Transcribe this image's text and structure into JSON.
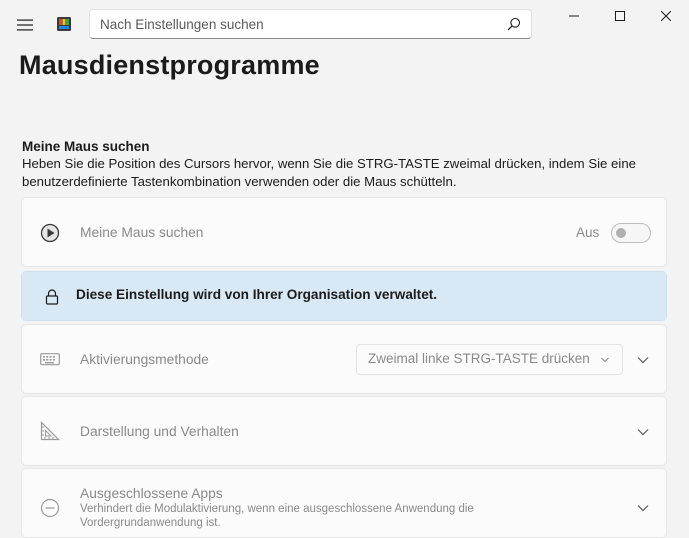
{
  "search": {
    "placeholder": "Nach Einstellungen suchen"
  },
  "page": {
    "title": "Mausdienstprogramme"
  },
  "section": {
    "title": "Meine Maus suchen",
    "description": "Heben Sie die Position des Cursors hervor, wenn Sie die STRG-TASTE zweimal drücken, indem Sie eine benutzerdefinierte Tastenkombination verwenden oder die Maus schütteln."
  },
  "enable_card": {
    "label": "Meine Maus suchen",
    "toggle_state": "Aus",
    "toggle_on": false
  },
  "info_bar": {
    "text": "Diese Einstellung wird von Ihrer Organisation verwaltet."
  },
  "activation_card": {
    "label": "Aktivierungsmethode",
    "selected_value": "Zweimal linke STRG-TASTE drücken"
  },
  "appearance_card": {
    "label": "Darstellung und Verhalten"
  },
  "excluded_card": {
    "label": "Ausgeschlossene Apps",
    "description": "Verhindert die Modulaktivierung, wenn eine ausgeschlossene Anwendung die Vordergrundanwendung ist."
  },
  "colors": {
    "info_background": "#d9e8f5",
    "card_background": "#fbfbfb",
    "window_background": "#f3f3f3",
    "disabled_text": "#8a8a8a"
  },
  "icons": {
    "menu": "hamburger-icon",
    "app": "powertoys-icon",
    "search": "search-icon",
    "minimize": "minimize-icon",
    "maximize": "maximize-icon",
    "close": "close-icon",
    "enable": "find-mouse-icon",
    "info": "lock-icon",
    "activation": "keyboard-icon",
    "appearance": "appearance-icon",
    "excluded": "block-icon",
    "expand": "chevron-down-icon"
  }
}
